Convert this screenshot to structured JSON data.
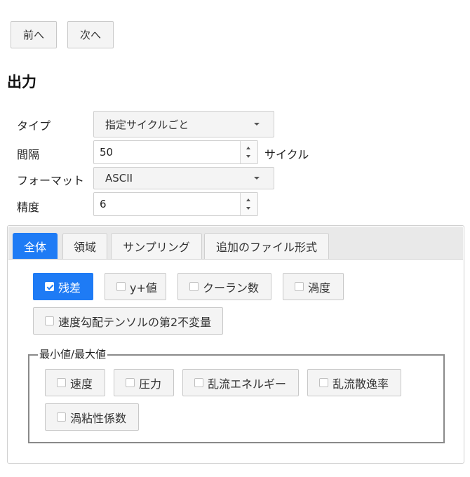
{
  "nav": {
    "prev_label": "前へ",
    "next_label": "次へ"
  },
  "section_title": "出力",
  "form": {
    "type": {
      "label": "タイプ",
      "value": "指定サイクルごと"
    },
    "interval": {
      "label": "間隔",
      "value": "50",
      "unit": "サイクル"
    },
    "format": {
      "label": "フォーマット",
      "value": "ASCII"
    },
    "precision": {
      "label": "精度",
      "value": "6"
    }
  },
  "tabs": [
    {
      "label": "全体",
      "active": true
    },
    {
      "label": "領域",
      "active": false
    },
    {
      "label": "サンプリング",
      "active": false
    },
    {
      "label": "追加のファイル形式",
      "active": false
    }
  ],
  "checkboxes": [
    {
      "label": "残差",
      "checked": true
    },
    {
      "label": "y+値",
      "checked": false
    },
    {
      "label": "クーラン数",
      "checked": false
    },
    {
      "label": "渦度",
      "checked": false
    },
    {
      "label": "速度勾配テンソルの第2不変量",
      "checked": false
    }
  ],
  "minmax": {
    "legend": "最小値/最大値",
    "checkboxes": [
      {
        "label": "速度",
        "checked": false
      },
      {
        "label": "圧力",
        "checked": false
      },
      {
        "label": "乱流エネルギー",
        "checked": false
      },
      {
        "label": "乱流散逸率",
        "checked": false
      },
      {
        "label": "渦粘性係数",
        "checked": false
      }
    ]
  },
  "colors": {
    "accent": "#1e7bf5"
  }
}
